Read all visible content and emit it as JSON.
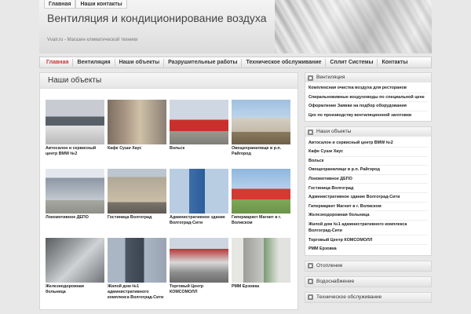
{
  "header": {
    "top_links": [
      "Главная",
      "Наши контакты"
    ],
    "title": "Вентиляция и кондиционирование воздуха",
    "tagline": "Vvair.ru - Магазин климатической техники"
  },
  "nav": {
    "items": [
      "Главная",
      "Вентиляция",
      "Наши объекты",
      "Разрушительные работы",
      "Техническое обслуживание",
      "Сплит Системы",
      "Контакты"
    ]
  },
  "content": {
    "title": "Наши объекты",
    "items": [
      {
        "caption": "Автосалон и сервисный центр BMW №2"
      },
      {
        "caption": "Кафе Суши Хаус"
      },
      {
        "caption": "Вольск"
      },
      {
        "caption": "Овощехранилище в р.п. Райгород"
      },
      {
        "caption": "Локомотивное ДЕПО"
      },
      {
        "caption": "Гостиница Волгоград"
      },
      {
        "caption": "Административное здание Волгоград-Сити"
      },
      {
        "caption": "Гипермаркет Магнит в г. Волжском"
      },
      {
        "caption": "Железнодорожная больница"
      },
      {
        "caption": "Жилой дом №1 административного комплекса Волгоград-Сити"
      },
      {
        "caption": "Торговый Центр КОМСОМОЛЛ"
      },
      {
        "caption": "РММ Ерзовка"
      }
    ]
  },
  "sidebar": {
    "widgets": [
      {
        "title": "Вентиляция",
        "links": [
          "Комплексная очистка воздуха для ресторанов",
          "Спиральновивные воздуховоды по специальной цене",
          "Оформление Заявки на подбор оборудования",
          "Цех по производству вентиляционной заготовки"
        ]
      },
      {
        "title": "Наши объекты",
        "links": [
          "Автосалон и сервисный центр BMW №2",
          "Кафе Суши Хаус",
          "Вольск",
          "Овощехранилище в р.п. Райгород",
          "Локомотивное ДЕПО",
          "Гостиница Волгоград",
          "Административное здание Волгоград-Сити",
          "Гипермаркет Магнит в г. Волжском",
          "Железнодорожная больница",
          "Жилой дом №1 административного комплекса Волгоград-Сити",
          "Торговый Центр КОМСОМОЛЛ",
          "РММ Ерзовка"
        ]
      },
      {
        "title": "Отопление",
        "links": []
      },
      {
        "title": "Водоснабжение",
        "links": []
      },
      {
        "title": "Техническое обслуживание",
        "links": []
      }
    ]
  }
}
